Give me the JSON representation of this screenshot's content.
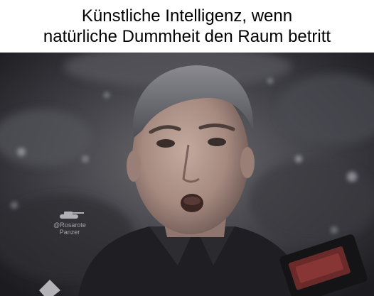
{
  "caption": {
    "line1": "Künstliche Intelligenz, wenn",
    "line2": "natürliche Dummheit den Raum betritt"
  },
  "photo": {
    "subject": "man-face-surprised",
    "watermark_handle": "@Rosarote",
    "watermark_name": "Panzer"
  },
  "colors": {
    "caption_bg": "#ffffff",
    "caption_text": "#000000",
    "photo_dark": "#1e1e22",
    "skin": "#b59a8e",
    "hair": "#6c6c72"
  }
}
